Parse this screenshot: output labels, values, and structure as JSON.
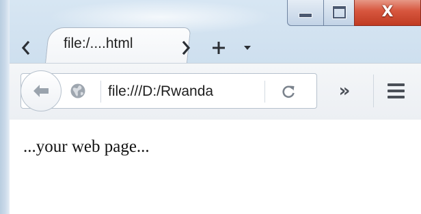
{
  "window": {
    "minimize_icon": "minimize-icon",
    "maximize_icon": "maximize-icon",
    "close_icon": "close-icon",
    "close_glyph": "X",
    "close_color": "#c8442b"
  },
  "tabs": {
    "scroll_left_icon": "chevron-left-icon",
    "scroll_right_icon": "chevron-right-icon",
    "new_tab_icon": "plus-icon",
    "list_icon": "caret-down-icon",
    "items": [
      {
        "label": "file:/....html",
        "active": true
      }
    ]
  },
  "navbar": {
    "back_icon": "arrow-left-icon",
    "site_icon": "globe-icon",
    "url": "file:///D:/Rwanda",
    "reload_icon": "reload-icon",
    "overflow_glyph": "»",
    "overflow_icon": "double-chevron-right-icon",
    "menu_icon": "hamburger-menu-icon"
  },
  "content": {
    "text": "...your web page..."
  }
}
